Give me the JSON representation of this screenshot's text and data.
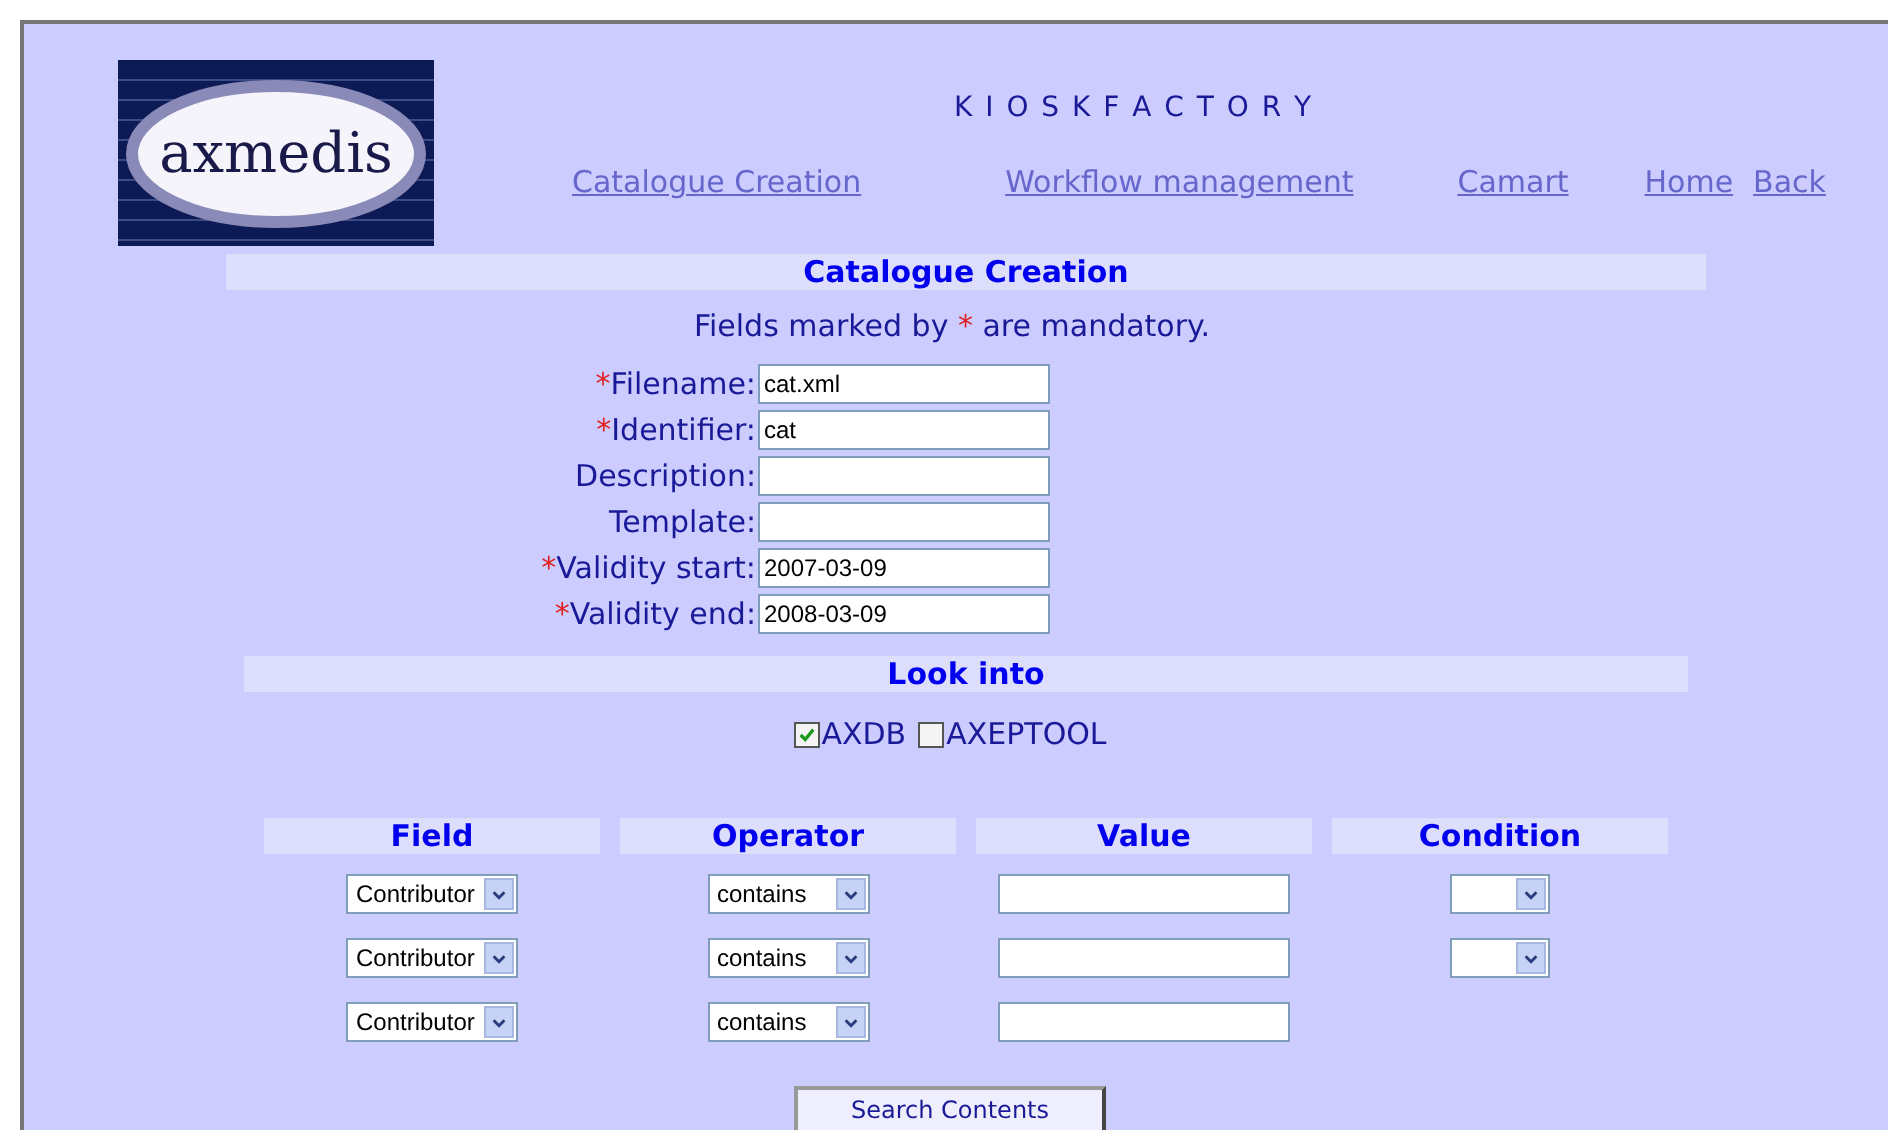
{
  "header": {
    "logo": "axmedis",
    "title": "K I O S K F A C T O R Y"
  },
  "nav": [
    {
      "label": "Catalogue Creation"
    },
    {
      "label": "Workflow management"
    },
    {
      "label": "Camart"
    },
    {
      "label": "Home"
    },
    {
      "label": "Back"
    }
  ],
  "section_title": "Catalogue Creation",
  "note": {
    "before": "Fields marked by",
    "mark": "*",
    "after": "are mandatory."
  },
  "fields": [
    {
      "label": "Filename:",
      "required": true,
      "value": "cat.xml"
    },
    {
      "label": "Identifier:",
      "required": true,
      "value": "cat"
    },
    {
      "label": "Description:",
      "required": false
    },
    {
      "label": "Template:",
      "required": false
    },
    {
      "label": "Validity start:",
      "required": true,
      "value": "2007-03-09"
    },
    {
      "label": "Validity end:",
      "required": true,
      "value": "2008-03-09"
    }
  ],
  "look_into": {
    "title": "Look into",
    "sources": [
      {
        "label": "AXDB",
        "checked": true
      },
      {
        "label": "AXEPTOOL",
        "checked": false
      }
    ]
  },
  "search": {
    "columns": [
      "Field",
      "Operator",
      "Value",
      "Condition"
    ],
    "rows": [
      {
        "field": "Contributor",
        "operator": "contains",
        "condition_select": true
      },
      {
        "field": "Contributor",
        "operator": "contains",
        "condition_select": true
      },
      {
        "field": "Contributor",
        "operator": "contains",
        "condition_select": false
      }
    ],
    "button": "Search Contents"
  }
}
